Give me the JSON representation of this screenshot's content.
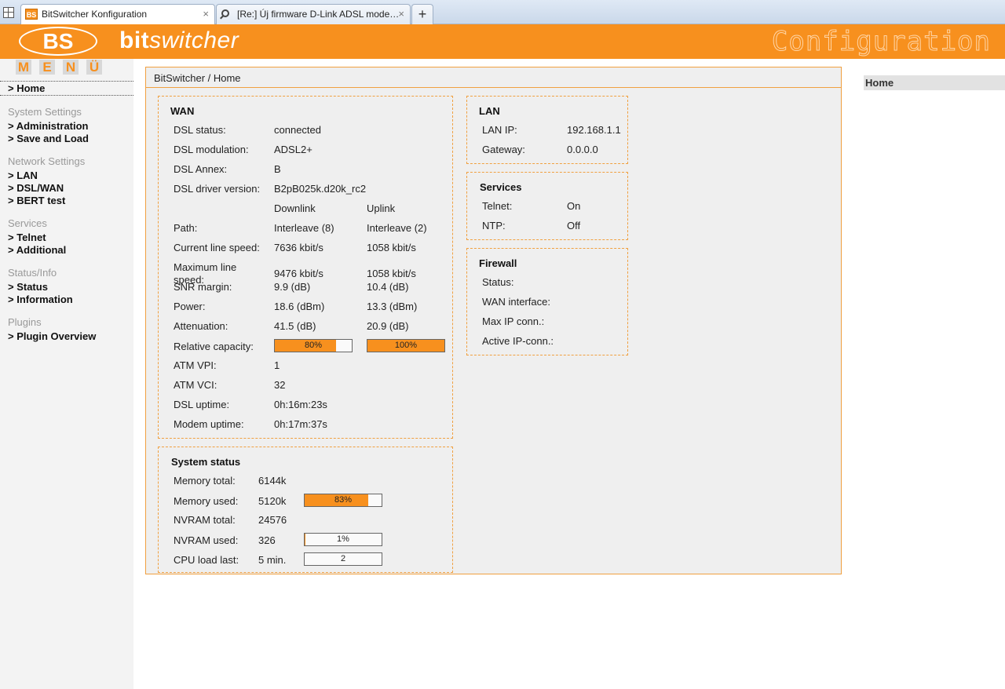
{
  "browser": {
    "tabs": [
      {
        "title": "BitSwitcher Konfiguration",
        "favicon": "BS"
      },
      {
        "title": "[Re:] Új firmware D-Link ADSL mode…"
      }
    ],
    "close_glyph": "×",
    "new_tab_glyph": "+"
  },
  "header": {
    "logo": "BS",
    "brand_bold": "bit",
    "brand_rest": "switcher",
    "title": "Configuration"
  },
  "sidebar": {
    "menu_letters": [
      "M",
      "E",
      "N",
      "Ü"
    ],
    "home": "> Home",
    "groups": [
      {
        "heading": "System Settings",
        "items": [
          "> Administration",
          "> Save and Load"
        ]
      },
      {
        "heading": "Network Settings",
        "items": [
          "> LAN",
          "> DSL/WAN",
          "> BERT test"
        ]
      },
      {
        "heading": "Services",
        "items": [
          "> Telnet",
          "> Additional"
        ]
      },
      {
        "heading": "Status/Info",
        "items": [
          "> Status",
          "> Information"
        ]
      },
      {
        "heading": "Plugins",
        "items": [
          "> Plugin Overview"
        ]
      }
    ]
  },
  "breadcrumb": "BitSwitcher / Home",
  "wan": {
    "title": "WAN",
    "dsl_status_label": "DSL status:",
    "dsl_status": "connected",
    "dsl_modulation_label": "DSL modulation:",
    "dsl_modulation": "ADSL2+",
    "dsl_annex_label": "DSL Annex:",
    "dsl_annex": "B",
    "driver_label": "DSL driver version:",
    "driver": "B2pB025k.d20k_rc2",
    "downlink_head": "Downlink",
    "uplink_head": "Uplink",
    "path_label": "Path:",
    "path_down": "Interleave (8)",
    "path_up": "Interleave (2)",
    "cur_speed_label": "Current line speed:",
    "cur_speed_down": "7636 kbit/s",
    "cur_speed_up": "1058 kbit/s",
    "max_speed_label": "Maximum line speed:",
    "max_speed_down": "9476 kbit/s",
    "max_speed_up": "1058 kbit/s",
    "snr_label": "SNR margin:",
    "snr_down": "9.9 (dB)",
    "snr_up": "10.4 (dB)",
    "power_label": "Power:",
    "power_down": "18.6 (dBm)",
    "power_up": "13.3 (dBm)",
    "atten_label": "Attenuation:",
    "atten_down": "41.5 (dB)",
    "atten_up": "20.9 (dB)",
    "capacity_label": "Relative capacity:",
    "capacity_down": "80%",
    "capacity_up": "100%",
    "capacity_down_fraction": 0.8,
    "capacity_up_fraction": 1.0,
    "vpi_label": "ATM VPI:",
    "vpi": "1",
    "vci_label": "ATM VCI:",
    "vci": "32",
    "dsl_uptime_label": "DSL uptime:",
    "dsl_uptime": "0h:16m:23s",
    "modem_uptime_label": "Modem uptime:",
    "modem_uptime": "0h:17m:37s"
  },
  "system": {
    "title": "System status",
    "mem_total_label": "Memory total:",
    "mem_total": "6144k",
    "mem_used_label": "Memory used:",
    "mem_used": "5120k",
    "mem_used_pct": "83%",
    "mem_used_fraction": 0.83,
    "nvram_total_label": "NVRAM total:",
    "nvram_total": "24576",
    "nvram_used_label": "NVRAM used:",
    "nvram_used": "326",
    "nvram_used_pct": "1%",
    "nvram_used_fraction": 0.01,
    "cpu_label": "CPU load last:",
    "cpu_period": "5 min.",
    "cpu_value": "2",
    "cpu_fraction": 0.0
  },
  "lan": {
    "title": "LAN",
    "ip_label": "LAN IP:",
    "ip": "192.168.1.1",
    "gw_label": "Gateway:",
    "gw": "0.0.0.0"
  },
  "services": {
    "title": "Services",
    "telnet_label": "Telnet:",
    "telnet": "On",
    "ntp_label": "NTP:",
    "ntp": "Off"
  },
  "firewall": {
    "title": "Firewall",
    "status_label": "Status:",
    "wan_if_label": "WAN interface:",
    "max_conn_label": "Max IP conn.:",
    "active_conn_label": "Active IP-conn.:"
  },
  "right": {
    "home": "Home"
  },
  "colors": {
    "accent": "#f7901e"
  }
}
